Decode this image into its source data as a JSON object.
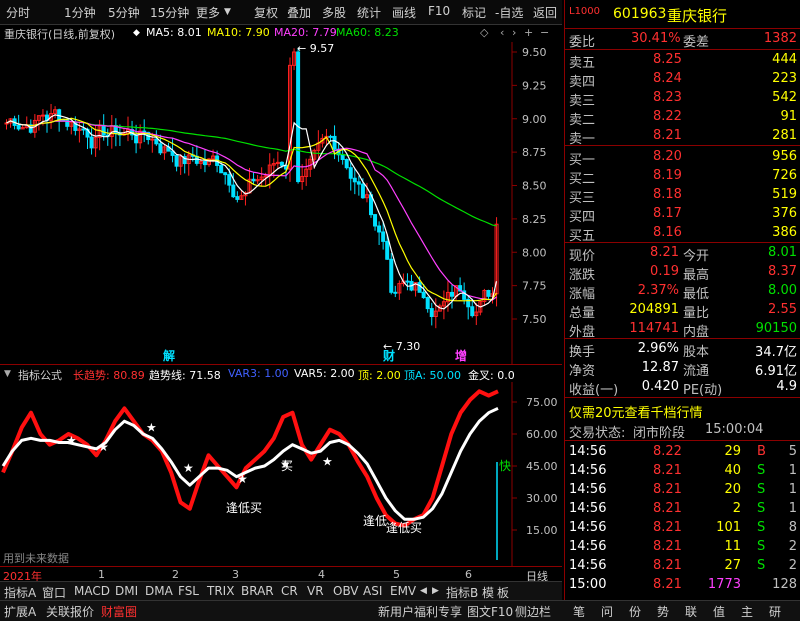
{
  "toolbar": {
    "left_items": [
      "分时",
      "1分钟",
      "5分钟",
      "15分钟",
      "更多"
    ],
    "right_items": [
      "复权",
      "叠加",
      "多股",
      "统计",
      "画线",
      "F10",
      "标记",
      "-自选",
      "返回"
    ]
  },
  "main": {
    "title": "重庆银行(日线,前复权)",
    "ma": [
      {
        "label": "MA5: 8.01",
        "color": "#ffffff"
      },
      {
        "label": "MA10: 7.90",
        "color": "#ffff00"
      },
      {
        "label": "MA20: 7.79",
        "color": "#ff40ff"
      },
      {
        "label": "MA60: 8.23",
        "color": "#00e000"
      }
    ],
    "y_ticks": [
      "9.50",
      "9.25",
      "9.00",
      "8.75",
      "8.50",
      "8.25",
      "8.00",
      "7.75",
      "7.50"
    ],
    "high_label": "9.57",
    "low_label": "7.30",
    "event_labels": [
      "解",
      "财",
      "增"
    ]
  },
  "indicator": {
    "name": "指标公式",
    "parts": [
      {
        "text": "长趋势: 80.89",
        "color": "#ff3030"
      },
      {
        "text": "趋势线: 71.58",
        "color": "#ffffff"
      },
      {
        "text": "VAR3: 1.00",
        "color": "#4060ff"
      },
      {
        "text": "VAR5: 2.00",
        "color": "#ffffff"
      },
      {
        "text": "顶: 2.00",
        "color": "#ffff00"
      },
      {
        "text": "顶A: 50.00",
        "color": "#00e0ff"
      },
      {
        "text": "金叉: 0.0",
        "color": "#ffffff"
      }
    ],
    "y_ticks": [
      "75.00",
      "60.00",
      "45.00",
      "30.00",
      "15.00"
    ],
    "annotations": [
      "逢低买",
      "逢低",
      "逢低买",
      "买",
      "快"
    ],
    "footer_note": "用到未来数据"
  },
  "time_axis": {
    "year": "2021年",
    "months": [
      "1",
      "2",
      "3",
      "4",
      "5",
      "6"
    ],
    "period": "日线"
  },
  "tabs_row1": [
    "指标A",
    "窗口",
    "MACD",
    "DMI",
    "DMA",
    "FSL",
    "TRIX",
    "BRAR",
    "CR",
    "VR",
    "OBV",
    "ASI",
    "EMV",
    "◀",
    "▶",
    "指标B",
    "模",
    "板"
  ],
  "tabs_row2": [
    "扩展A",
    "关联报价",
    "财富圈"
  ],
  "tabs_row2_right": [
    "新用户福利专享",
    "图文F10",
    "侧边栏"
  ],
  "bottom_icons": [
    "笔",
    "问",
    "份",
    "势",
    "联",
    "值",
    "主",
    "研"
  ],
  "stock": {
    "code": "601963",
    "name": "重庆银行",
    "badge": "L1000"
  },
  "weibi": {
    "label": "委比",
    "value": "30.41%",
    "label2": "委差",
    "value2": "1382"
  },
  "asks": [
    {
      "label": "卖五",
      "price": "8.25",
      "vol": "444"
    },
    {
      "label": "卖四",
      "price": "8.24",
      "vol": "223"
    },
    {
      "label": "卖三",
      "price": "8.23",
      "vol": "542"
    },
    {
      "label": "卖二",
      "price": "8.22",
      "vol": "91"
    },
    {
      "label": "卖一",
      "price": "8.21",
      "vol": "281"
    }
  ],
  "bids": [
    {
      "label": "买一",
      "price": "8.20",
      "vol": "956"
    },
    {
      "label": "买二",
      "price": "8.19",
      "vol": "726"
    },
    {
      "label": "买三",
      "price": "8.18",
      "vol": "519"
    },
    {
      "label": "买四",
      "price": "8.17",
      "vol": "376"
    },
    {
      "label": "买五",
      "price": "8.16",
      "vol": "386"
    }
  ],
  "quote": [
    {
      "l1": "现价",
      "v1": "8.21",
      "c1": "#ff3030",
      "l2": "今开",
      "v2": "8.01",
      "c2": "#00e000"
    },
    {
      "l1": "涨跌",
      "v1": "0.19",
      "c1": "#ff3030",
      "l2": "最高",
      "v2": "8.37",
      "c2": "#ff3030"
    },
    {
      "l1": "涨幅",
      "v1": "2.37%",
      "c1": "#ff3030",
      "l2": "最低",
      "v2": "8.00",
      "c2": "#00e000"
    },
    {
      "l1": "总量",
      "v1": "204891",
      "c1": "#ffff00",
      "l2": "量比",
      "v2": "2.55",
      "c2": "#ff3030"
    },
    {
      "l1": "外盘",
      "v1": "114741",
      "c1": "#ff3030",
      "l2": "内盘",
      "v2": "90150",
      "c2": "#00e000"
    }
  ],
  "stats": [
    {
      "l1": "换手",
      "v1": "2.96%",
      "l2": "股本",
      "v2": "34.7亿"
    },
    {
      "l1": "净资",
      "v1": "12.87",
      "l2": "流通",
      "v2": "6.91亿"
    },
    {
      "l1": "收益(一)",
      "v1": "0.420",
      "l2": "PE(动)",
      "v2": "4.9"
    }
  ],
  "promo": "仅需20元查看千档行情",
  "trade_status": {
    "label": "交易状态:",
    "value": "闭市阶段",
    "time": "15:00:04"
  },
  "ticks": [
    {
      "time": "14:56",
      "price": "8.22",
      "vol": "29",
      "side": "B",
      "n": "5"
    },
    {
      "time": "14:56",
      "price": "8.21",
      "vol": "40",
      "side": "S",
      "n": "1"
    },
    {
      "time": "14:56",
      "price": "8.21",
      "vol": "20",
      "side": "S",
      "n": "1"
    },
    {
      "time": "14:56",
      "price": "8.21",
      "vol": "2",
      "side": "S",
      "n": "1"
    },
    {
      "time": "14:56",
      "price": "8.21",
      "vol": "101",
      "side": "S",
      "n": "8"
    },
    {
      "time": "14:56",
      "price": "8.21",
      "vol": "11",
      "side": "S",
      "n": "2"
    },
    {
      "time": "14:56",
      "price": "8.21",
      "vol": "27",
      "side": "S",
      "n": "2"
    },
    {
      "time": "15:00",
      "price": "8.21",
      "vol": "1773",
      "side": "",
      "n": "128"
    }
  ]
}
